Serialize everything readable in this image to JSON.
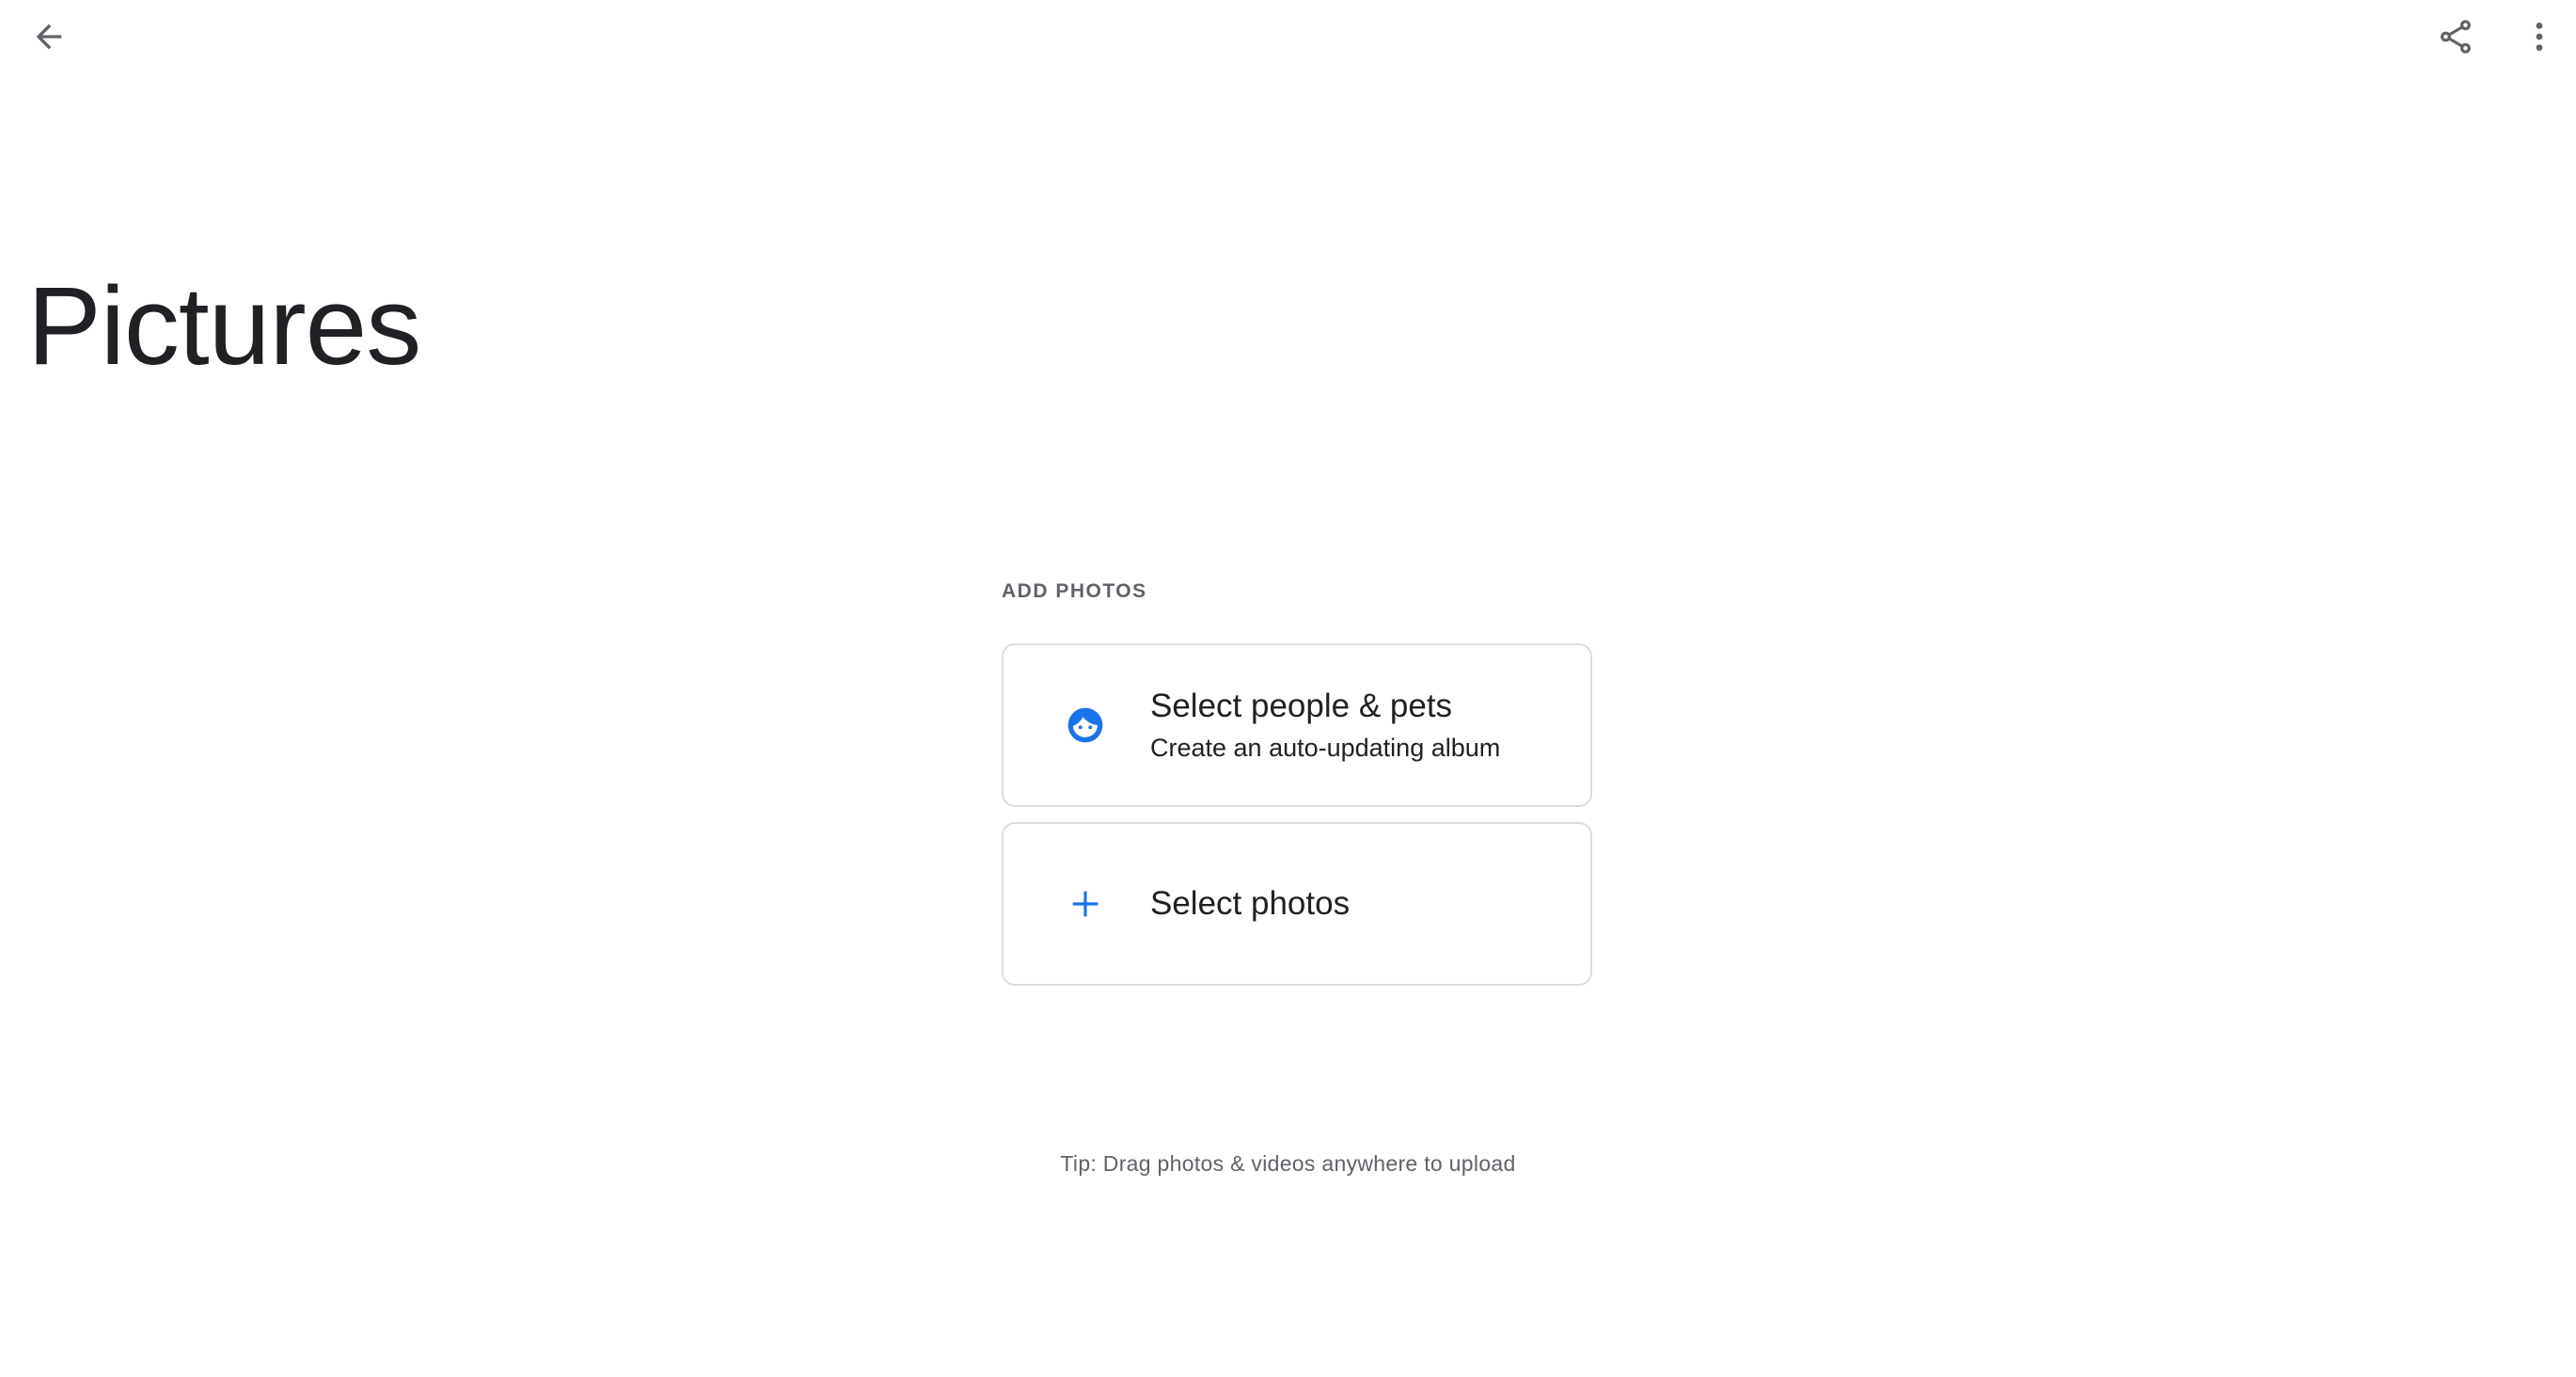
{
  "toolbar": {
    "back_icon": "arrow-back-icon",
    "share_icon": "share-icon",
    "more_icon": "more-vert-icon"
  },
  "album": {
    "title": "Pictures"
  },
  "add_photos": {
    "section_label": "ADD PHOTOS",
    "options": [
      {
        "icon": "face-icon",
        "title": "Select people & pets",
        "subtitle": "Create an auto-updating album"
      },
      {
        "icon": "plus-icon",
        "title": "Select photos"
      }
    ]
  },
  "tip": "Tip: Drag photos & videos anywhere to upload",
  "colors": {
    "accent": "#1a73e8",
    "icon_gray": "#5f6368",
    "text": "#202124",
    "border": "#dadce0"
  }
}
